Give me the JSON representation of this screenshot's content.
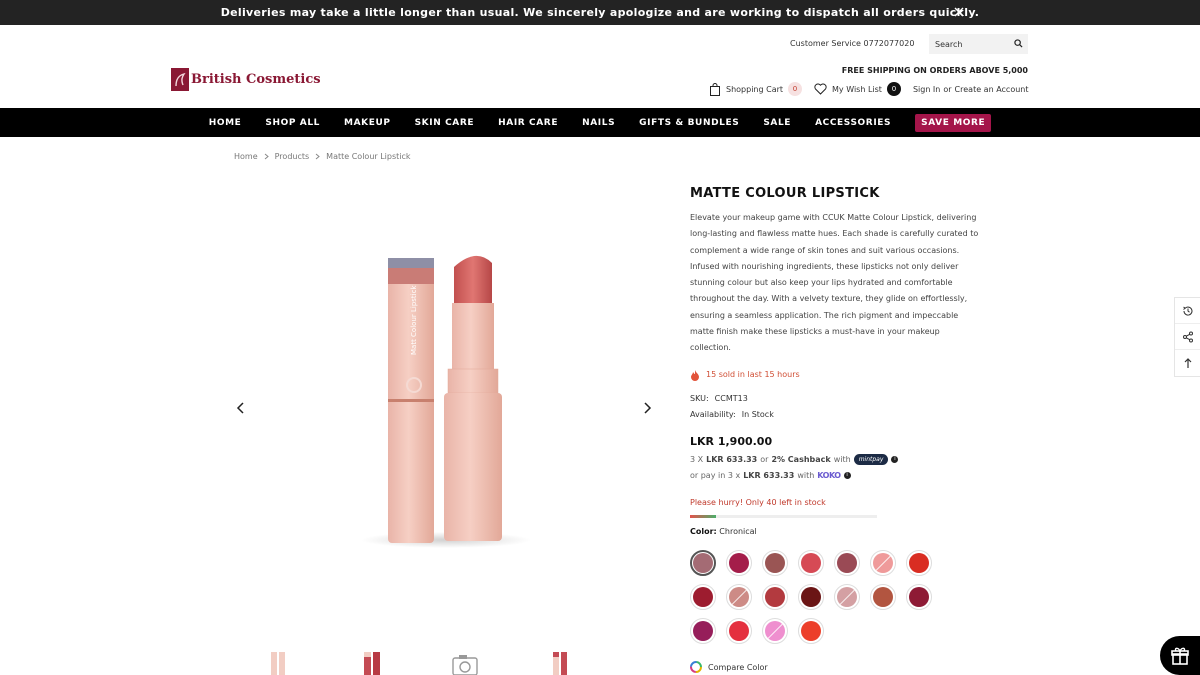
{
  "announcement": "Deliveries may take a little longer than usual. We sincerely apologize and are working to dispatch all orders quickly.",
  "header": {
    "customer_service": "Customer Service 0772077020",
    "search_placeholder": "Search",
    "logo_text": "British Cosmetics",
    "shipping_note": "FREE SHIPPING ON ORDERS ABOVE 5,000",
    "cart_label": "Shopping Cart",
    "cart_count": "0",
    "wishlist_label": "My Wish List",
    "wishlist_count": "0",
    "sign_in": "Sign In",
    "or": "or",
    "create_account": "Create an Account"
  },
  "nav": [
    "HOME",
    "SHOP ALL",
    "MAKEUP",
    "SKIN CARE",
    "HAIR CARE",
    "NAILS",
    "GIFTS & BUNDLES",
    "SALE",
    "ACCESSORIES",
    "SAVE MORE"
  ],
  "breadcrumb": [
    "Home",
    "Products",
    "Matte Colour Lipstick"
  ],
  "product": {
    "title": "MATTE COLOUR LIPSTICK",
    "description": "Elevate your makeup game with CCUK Matte Colour Lipstick, delivering long-lasting and flawless matte hues. Each shade is carefully curated to complement a wide range of skin tones and suit various occasions. Infused with nourishing ingredients, these lipsticks not only deliver stunning colour but also keep your lips hydrated and comfortable throughout the day. With a velvety texture, they glide on effortlessly, ensuring a seamless application. The rich pigment and impeccable matte finish make these lipsticks a must-have in your makeup collection.",
    "sold_note": "15 sold in last 15 hours",
    "sku_label": "SKU:",
    "sku": "CCMT13",
    "availability_label": "Availability:",
    "availability": "In Stock",
    "price": "LKR 1,900.00",
    "mintpay": {
      "prefix": "3 X",
      "amount": "LKR 633.33",
      "or": "or",
      "cashback": "2% Cashback",
      "with": "with",
      "brand": "mintpay"
    },
    "koko": {
      "prefix": "or pay in 3 x",
      "amount": "LKR 633.33",
      "with": "with",
      "brand": "KOKO"
    },
    "hurry": "Please hurry! Only 40 left in stock",
    "stock_fraction": 0.14,
    "color_label": "Color:",
    "color_value": "Chronical",
    "compare": "Compare Color",
    "tube_text": "Matt Colour Lipstick"
  },
  "swatches": [
    {
      "color": "#a46b74",
      "selected": true,
      "oos": false
    },
    {
      "color": "#a41d4a",
      "selected": false,
      "oos": false
    },
    {
      "color": "#9a5554",
      "selected": false,
      "oos": false
    },
    {
      "color": "#d64a55",
      "selected": false,
      "oos": false
    },
    {
      "color": "#9a4a55",
      "selected": false,
      "oos": false
    },
    {
      "color": "#ef9a9a",
      "selected": false,
      "oos": true
    },
    {
      "color": "#d92d22",
      "selected": false,
      "oos": false
    },
    {
      "color": "#9d1c2f",
      "selected": false,
      "oos": false
    },
    {
      "color": "#cd8b86",
      "selected": false,
      "oos": true
    },
    {
      "color": "#b33a3f",
      "selected": false,
      "oos": false
    },
    {
      "color": "#6b1515",
      "selected": false,
      "oos": false
    },
    {
      "color": "#d4a0a3",
      "selected": false,
      "oos": true
    },
    {
      "color": "#b25540",
      "selected": false,
      "oos": false
    },
    {
      "color": "#8e1a35",
      "selected": false,
      "oos": false
    },
    {
      "color": "#961e5a",
      "selected": false,
      "oos": false
    },
    {
      "color": "#e4303f",
      "selected": false,
      "oos": false
    },
    {
      "color": "#ef8fcf",
      "selected": false,
      "oos": true
    },
    {
      "color": "#ec3f2a",
      "selected": false,
      "oos": false
    }
  ]
}
